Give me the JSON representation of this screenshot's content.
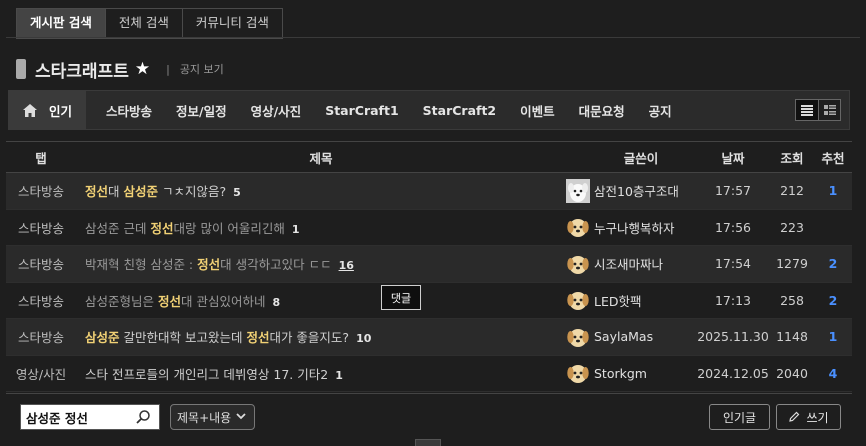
{
  "search_tabs": [
    {
      "label": "게시판 검색",
      "active": true
    },
    {
      "label": "전체 검색",
      "active": false
    },
    {
      "label": "커뮤니티 검색",
      "active": false
    }
  ],
  "board": {
    "title": "스타크래프트",
    "separator": "|",
    "notice_link": "공지 보기"
  },
  "categories": {
    "home_label": "인기",
    "items": [
      "스타방송",
      "정보/일정",
      "영상/사진",
      "StarCraft1",
      "StarCraft2",
      "이벤트",
      "대문요청",
      "공지"
    ]
  },
  "table": {
    "headers": {
      "tab": "탭",
      "title": "제목",
      "author": "글쓴이",
      "date": "날짜",
      "views": "조회",
      "rec": "추천"
    },
    "rows": [
      {
        "tab": "스타방송",
        "title_parts": [
          {
            "t": "정선",
            "hl": true
          },
          {
            "t": "대 ",
            "hl": false
          },
          {
            "t": "삼성준",
            "hl": true
          },
          {
            "t": " ㄱㅊ지않음?",
            "hl": false
          }
        ],
        "comments": "5",
        "author": "삼전10층구조대",
        "avatar": "white-dog",
        "date": "17:57",
        "views": "212",
        "rec": "1",
        "visited": false
      },
      {
        "tab": "스타방송",
        "title_parts": [
          {
            "t": "삼성준 근데 ",
            "hl": false
          },
          {
            "t": "정선",
            "hl": true
          },
          {
            "t": "대랑 많이 어울리긴해",
            "hl": false
          }
        ],
        "comments": "1",
        "author": "누구나행복하자",
        "avatar": "puppy",
        "date": "17:56",
        "views": "223",
        "rec": "",
        "visited": true
      },
      {
        "tab": "스타방송",
        "title_parts": [
          {
            "t": "박재혁 친형 삼성준 : ",
            "hl": false
          },
          {
            "t": "정선",
            "hl": true
          },
          {
            "t": "대 생각하고있다 ㄷㄷ",
            "hl": false
          }
        ],
        "comments": "16",
        "author": "시조새마짜나",
        "avatar": "puppy",
        "date": "17:54",
        "views": "1279",
        "rec": "2",
        "visited": true
      },
      {
        "tab": "스타방송",
        "title_parts": [
          {
            "t": "삼성준형님은 ",
            "hl": false
          },
          {
            "t": "정선",
            "hl": true
          },
          {
            "t": "대 관심있어하네",
            "hl": false
          }
        ],
        "comments": "8",
        "author": "LED핫팩",
        "avatar": "puppy",
        "date": "17:13",
        "views": "258",
        "rec": "2",
        "visited": true
      },
      {
        "tab": "스타방송",
        "title_parts": [
          {
            "t": "삼성준",
            "hl": true
          },
          {
            "t": " 갈만한대학 보고왔는데 ",
            "hl": false
          },
          {
            "t": "정선",
            "hl": true
          },
          {
            "t": "대가 좋을지도?",
            "hl": false
          }
        ],
        "comments": "10",
        "author": "SaylaMas",
        "avatar": "puppy",
        "date": "2025.11.30",
        "views": "1148",
        "rec": "1",
        "visited": false
      },
      {
        "tab": "영상/사진",
        "title_parts": [
          {
            "t": "스타 전프로들의 개인리그 데뷔영상 17. 기타2",
            "hl": false
          }
        ],
        "comments": "1",
        "author": "Storkgm",
        "avatar": "puppy",
        "date": "2024.12.05",
        "views": "2040",
        "rec": "4",
        "visited": false
      }
    ]
  },
  "tooltip": "댓글",
  "search": {
    "value": "삼성준 정선",
    "type_label": "제목+내용"
  },
  "buttons": {
    "popular": "인기글",
    "write": "쓰기"
  },
  "colors": {
    "highlight": "#f1d175",
    "recommend": "#4a90ff",
    "background": "#1e1e1e"
  }
}
